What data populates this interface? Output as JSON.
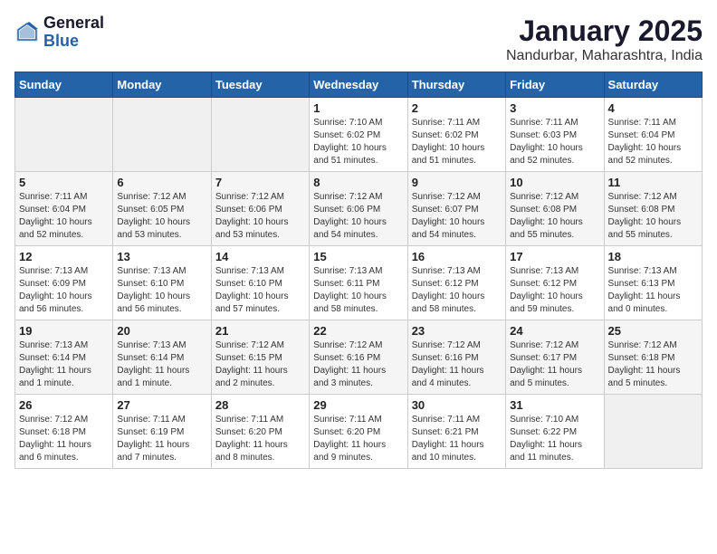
{
  "header": {
    "logo_general": "General",
    "logo_blue": "Blue",
    "title": "January 2025",
    "subtitle": "Nandurbar, Maharashtra, India"
  },
  "weekdays": [
    "Sunday",
    "Monday",
    "Tuesday",
    "Wednesday",
    "Thursday",
    "Friday",
    "Saturday"
  ],
  "weeks": [
    [
      {
        "day": "",
        "info": ""
      },
      {
        "day": "",
        "info": ""
      },
      {
        "day": "",
        "info": ""
      },
      {
        "day": "1",
        "info": "Sunrise: 7:10 AM\nSunset: 6:02 PM\nDaylight: 10 hours\nand 51 minutes."
      },
      {
        "day": "2",
        "info": "Sunrise: 7:11 AM\nSunset: 6:02 PM\nDaylight: 10 hours\nand 51 minutes."
      },
      {
        "day": "3",
        "info": "Sunrise: 7:11 AM\nSunset: 6:03 PM\nDaylight: 10 hours\nand 52 minutes."
      },
      {
        "day": "4",
        "info": "Sunrise: 7:11 AM\nSunset: 6:04 PM\nDaylight: 10 hours\nand 52 minutes."
      }
    ],
    [
      {
        "day": "5",
        "info": "Sunrise: 7:11 AM\nSunset: 6:04 PM\nDaylight: 10 hours\nand 52 minutes."
      },
      {
        "day": "6",
        "info": "Sunrise: 7:12 AM\nSunset: 6:05 PM\nDaylight: 10 hours\nand 53 minutes."
      },
      {
        "day": "7",
        "info": "Sunrise: 7:12 AM\nSunset: 6:06 PM\nDaylight: 10 hours\nand 53 minutes."
      },
      {
        "day": "8",
        "info": "Sunrise: 7:12 AM\nSunset: 6:06 PM\nDaylight: 10 hours\nand 54 minutes."
      },
      {
        "day": "9",
        "info": "Sunrise: 7:12 AM\nSunset: 6:07 PM\nDaylight: 10 hours\nand 54 minutes."
      },
      {
        "day": "10",
        "info": "Sunrise: 7:12 AM\nSunset: 6:08 PM\nDaylight: 10 hours\nand 55 minutes."
      },
      {
        "day": "11",
        "info": "Sunrise: 7:12 AM\nSunset: 6:08 PM\nDaylight: 10 hours\nand 55 minutes."
      }
    ],
    [
      {
        "day": "12",
        "info": "Sunrise: 7:13 AM\nSunset: 6:09 PM\nDaylight: 10 hours\nand 56 minutes."
      },
      {
        "day": "13",
        "info": "Sunrise: 7:13 AM\nSunset: 6:10 PM\nDaylight: 10 hours\nand 56 minutes."
      },
      {
        "day": "14",
        "info": "Sunrise: 7:13 AM\nSunset: 6:10 PM\nDaylight: 10 hours\nand 57 minutes."
      },
      {
        "day": "15",
        "info": "Sunrise: 7:13 AM\nSunset: 6:11 PM\nDaylight: 10 hours\nand 58 minutes."
      },
      {
        "day": "16",
        "info": "Sunrise: 7:13 AM\nSunset: 6:12 PM\nDaylight: 10 hours\nand 58 minutes."
      },
      {
        "day": "17",
        "info": "Sunrise: 7:13 AM\nSunset: 6:12 PM\nDaylight: 10 hours\nand 59 minutes."
      },
      {
        "day": "18",
        "info": "Sunrise: 7:13 AM\nSunset: 6:13 PM\nDaylight: 11 hours\nand 0 minutes."
      }
    ],
    [
      {
        "day": "19",
        "info": "Sunrise: 7:13 AM\nSunset: 6:14 PM\nDaylight: 11 hours\nand 1 minute."
      },
      {
        "day": "20",
        "info": "Sunrise: 7:13 AM\nSunset: 6:14 PM\nDaylight: 11 hours\nand 1 minute."
      },
      {
        "day": "21",
        "info": "Sunrise: 7:12 AM\nSunset: 6:15 PM\nDaylight: 11 hours\nand 2 minutes."
      },
      {
        "day": "22",
        "info": "Sunrise: 7:12 AM\nSunset: 6:16 PM\nDaylight: 11 hours\nand 3 minutes."
      },
      {
        "day": "23",
        "info": "Sunrise: 7:12 AM\nSunset: 6:16 PM\nDaylight: 11 hours\nand 4 minutes."
      },
      {
        "day": "24",
        "info": "Sunrise: 7:12 AM\nSunset: 6:17 PM\nDaylight: 11 hours\nand 5 minutes."
      },
      {
        "day": "25",
        "info": "Sunrise: 7:12 AM\nSunset: 6:18 PM\nDaylight: 11 hours\nand 5 minutes."
      }
    ],
    [
      {
        "day": "26",
        "info": "Sunrise: 7:12 AM\nSunset: 6:18 PM\nDaylight: 11 hours\nand 6 minutes."
      },
      {
        "day": "27",
        "info": "Sunrise: 7:11 AM\nSunset: 6:19 PM\nDaylight: 11 hours\nand 7 minutes."
      },
      {
        "day": "28",
        "info": "Sunrise: 7:11 AM\nSunset: 6:20 PM\nDaylight: 11 hours\nand 8 minutes."
      },
      {
        "day": "29",
        "info": "Sunrise: 7:11 AM\nSunset: 6:20 PM\nDaylight: 11 hours\nand 9 minutes."
      },
      {
        "day": "30",
        "info": "Sunrise: 7:11 AM\nSunset: 6:21 PM\nDaylight: 11 hours\nand 10 minutes."
      },
      {
        "day": "31",
        "info": "Sunrise: 7:10 AM\nSunset: 6:22 PM\nDaylight: 11 hours\nand 11 minutes."
      },
      {
        "day": "",
        "info": ""
      }
    ]
  ]
}
